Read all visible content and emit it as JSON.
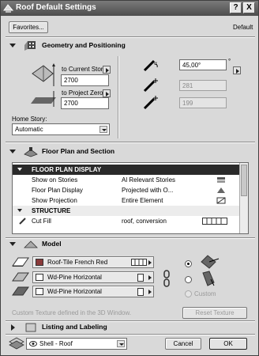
{
  "window": {
    "title": "Roof Default Settings",
    "help_btn": "?",
    "close_btn": "X"
  },
  "favorites_label": "Favorites...",
  "default_label": "Default",
  "geometry": {
    "title": "Geometry and Positioning",
    "to_current_story_label": "to Current Story",
    "to_current_story_value": "2700",
    "to_project_zero_label": "to Project Zero",
    "to_project_zero_value": "2700",
    "home_story_label": "Home Story:",
    "home_story_value": "Automatic",
    "angle_value": "45,00°",
    "degree_symbol": "°",
    "dim_value_1": "281",
    "dim_value_2": "199"
  },
  "floor_plan": {
    "title": "Floor Plan and Section",
    "rows": [
      {
        "c1": "FLOOR PLAN DISPLAY",
        "c2": "",
        "kind": "head"
      },
      {
        "c1": "Show on Stories",
        "c2": "Al Relevant Stories",
        "kind": "item"
      },
      {
        "c1": "Floor Plan Display",
        "c2": "Projected with O...",
        "kind": "item"
      },
      {
        "c1": "Show Projection",
        "c2": "Entire Element",
        "kind": "item"
      },
      {
        "c1": "STRUCTURE",
        "c2": "",
        "kind": "sub"
      },
      {
        "c1": "Cut Fill",
        "c2": "roof, conversion",
        "kind": "item"
      }
    ]
  },
  "model": {
    "title": "Model",
    "materials": [
      {
        "name": "Roof-Tile French Red",
        "swatch": "#8a3a3a"
      },
      {
        "name": "Wd-Pine Horizontal",
        "swatch": "#ffffff"
      },
      {
        "name": "Wd-Pine Horizontal",
        "swatch": "#ffffff"
      }
    ],
    "custom_label": "Custom",
    "note": "Custom Texture defined in the 3D Window.",
    "reset_texture": "Reset Texture"
  },
  "listing": {
    "title": "Listing and Labeling"
  },
  "footer": {
    "layer_value": "Shell - Roof",
    "cancel": "Cancel",
    "ok": "OK"
  }
}
